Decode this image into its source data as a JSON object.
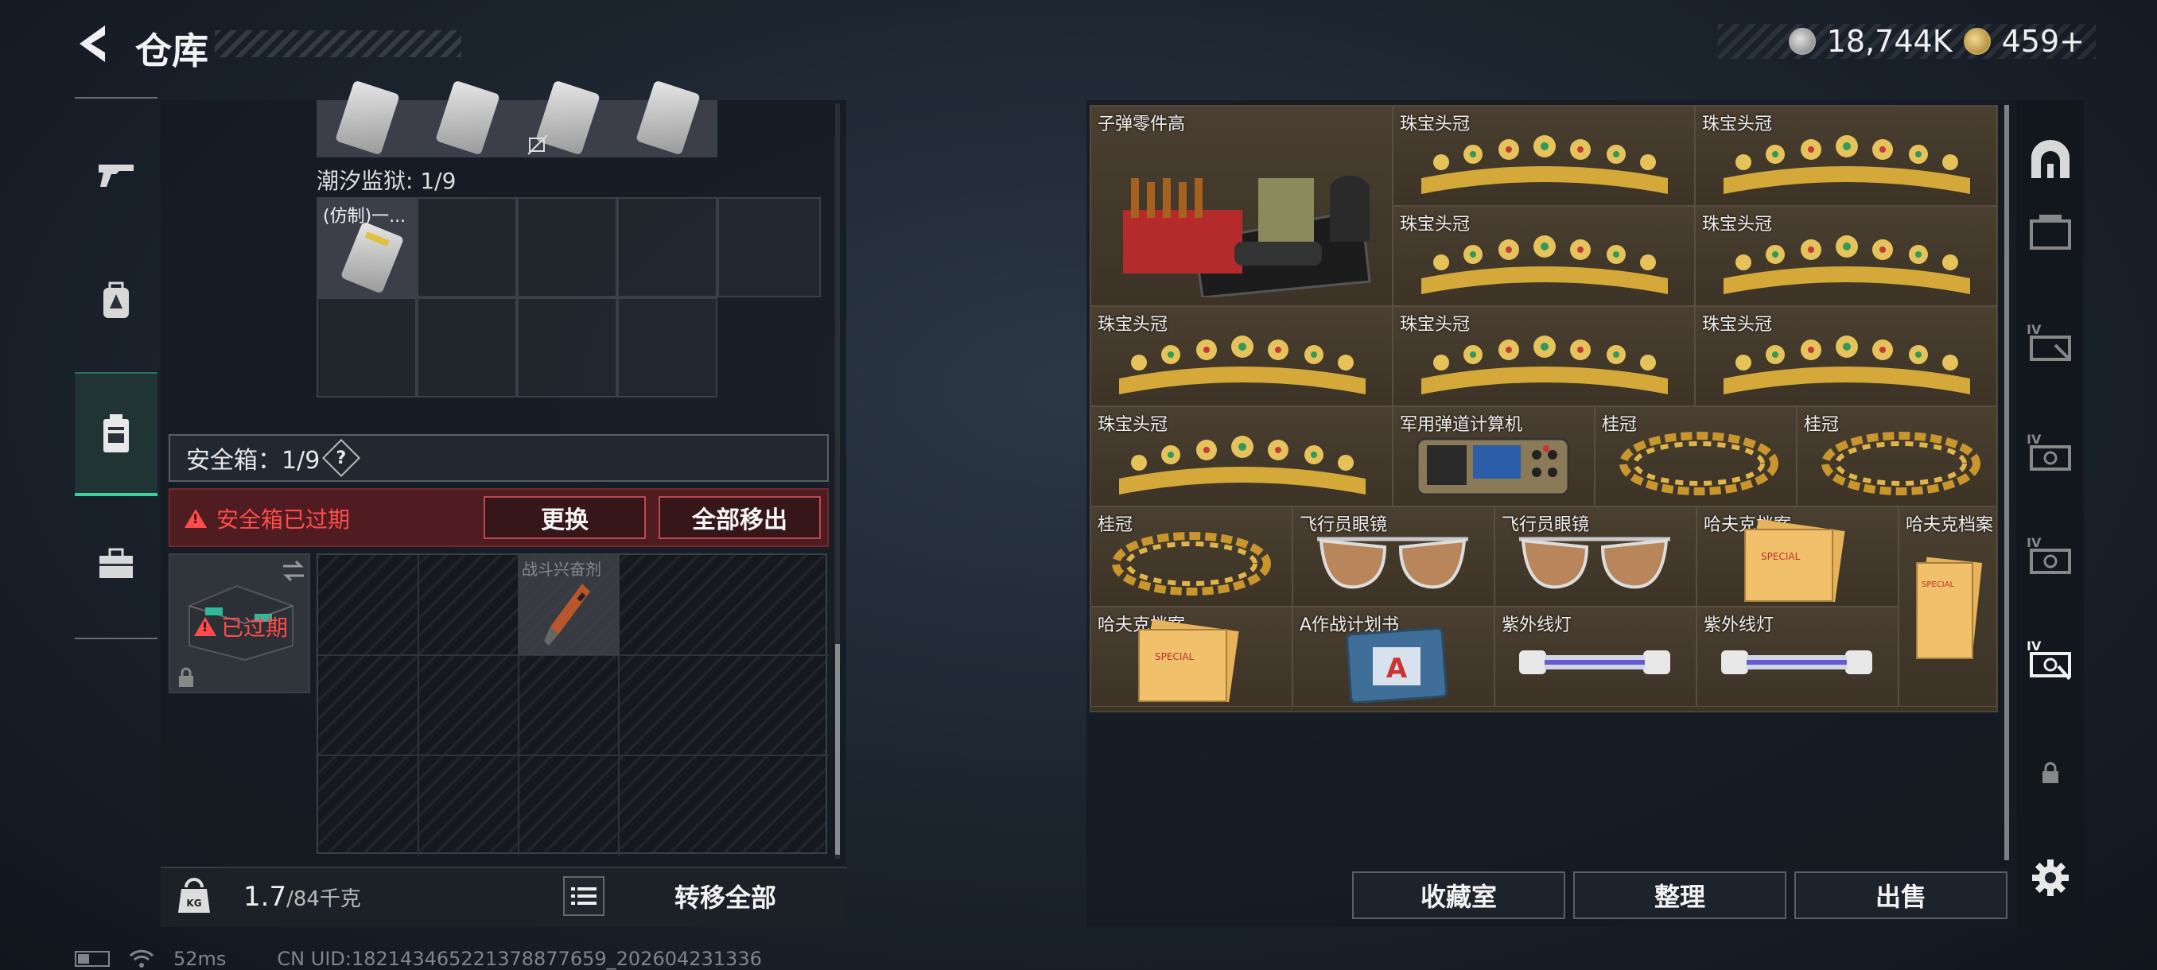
{
  "header": {
    "title": "仓库",
    "currency_silver": "18,744K",
    "currency_gold": "459+"
  },
  "left_panel": {
    "prison_label": "潮汐监狱: 1/9",
    "prison_item_label": "(仿制)一...",
    "safebox_label": "安全箱：1/9",
    "help_glyph": "?",
    "expired_warning": "安全箱已过期",
    "replace_button": "更换",
    "move_all_out_button": "全部移出",
    "safebox_expired_badge": "已过期",
    "stimulant_label": "战斗兴奋剂",
    "weight_current": "1.7",
    "weight_capacity": "/84千克",
    "weight_icon_text": "KG",
    "transfer_all_button": "转移全部"
  },
  "stash": {
    "items": [
      {
        "label": "子弹零件高",
        "art": "ammo-parts"
      },
      {
        "label": "珠宝头冠",
        "art": "tiara"
      },
      {
        "label": "珠宝头冠",
        "art": "tiara"
      },
      {
        "label": "珠宝头冠",
        "art": "tiara"
      },
      {
        "label": "珠宝头冠",
        "art": "tiara"
      },
      {
        "label": "珠宝头冠",
        "art": "tiara"
      },
      {
        "label": "珠宝头冠",
        "art": "tiara"
      },
      {
        "label": "珠宝头冠",
        "art": "tiara"
      },
      {
        "label": "珠宝头冠",
        "art": "tiara"
      },
      {
        "label": "军用弹道计算机",
        "art": "computer"
      },
      {
        "label": "桂冠",
        "art": "laurel"
      },
      {
        "label": "桂冠",
        "art": "laurel"
      },
      {
        "label": "桂冠",
        "art": "laurel"
      },
      {
        "label": "飞行员眼镜",
        "art": "glasses"
      },
      {
        "label": "飞行员眼镜",
        "art": "glasses"
      },
      {
        "label": "哈夫克档案",
        "art": "files"
      },
      {
        "label": "哈夫克档案",
        "art": "files"
      },
      {
        "label": "哈夫克档案",
        "art": "files"
      },
      {
        "label": "A作战计划书",
        "art": "plan"
      },
      {
        "label": "紫外线灯",
        "art": "uv-lamp"
      },
      {
        "label": "紫外线灯",
        "art": "uv-lamp"
      }
    ],
    "collection_button": "收藏室",
    "organize_button": "整理",
    "sell_button": "出售"
  },
  "status": {
    "ping": "52ms",
    "uid": "CN UID:182143465221378877659_202604231336"
  },
  "colors": {
    "accent_green": "#3bd39a",
    "warning_red": "#ff4b4b",
    "stash_gold": "#3a3326"
  }
}
